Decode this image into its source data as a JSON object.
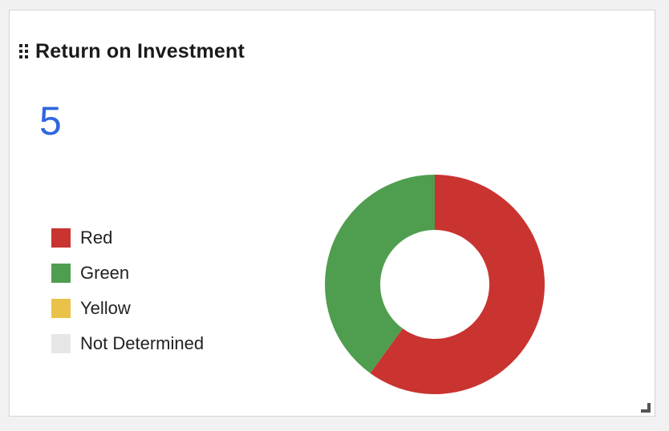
{
  "widget": {
    "title": "Return on Investment",
    "kpi_value": "5",
    "drag_icon": "drag-handle-icon",
    "resize_icon": "resize-corner-icon"
  },
  "colors": {
    "kpi": "#2f66e0",
    "red": "#c93330",
    "green": "#4f9e4f",
    "yellow": "#eac24a",
    "not_determined": "#e6e6e6"
  },
  "chart_data": {
    "type": "pie",
    "style": "donut",
    "title": "",
    "legend_position": "left",
    "series": [
      {
        "name": "Red",
        "value": 3,
        "color": "#c93330"
      },
      {
        "name": "Green",
        "value": 2,
        "color": "#4f9e4f"
      },
      {
        "name": "Yellow",
        "value": 0,
        "color": "#eac24a"
      },
      {
        "name": "Not Determined",
        "value": 0,
        "color": "#e6e6e6"
      }
    ]
  }
}
